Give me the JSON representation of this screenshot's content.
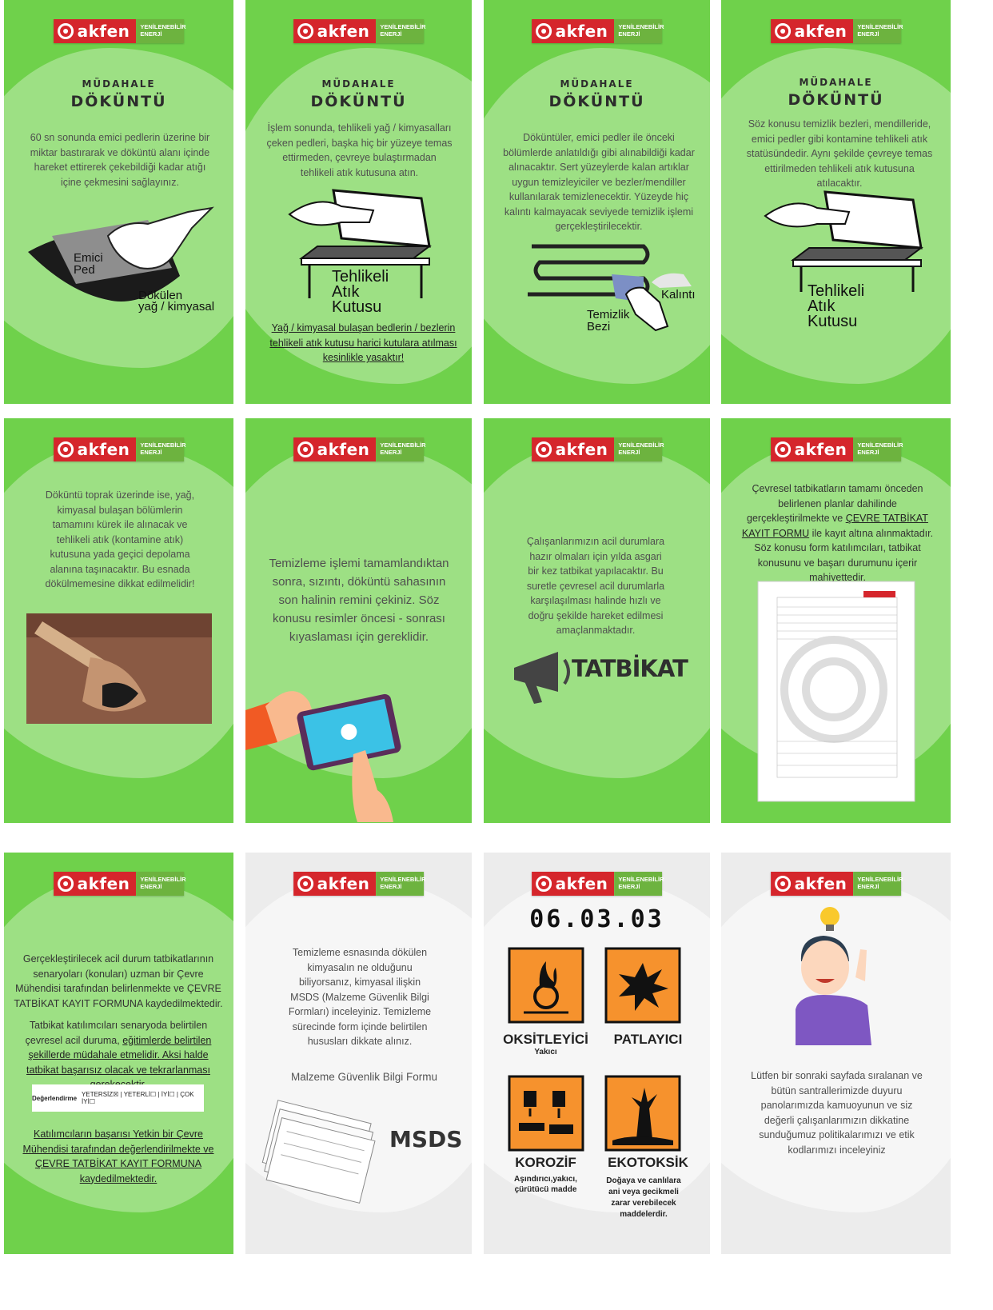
{
  "logo": {
    "brand": "akfen",
    "sub1": "YENİLENEBİLİR",
    "sub2": "ENERJİ"
  },
  "heading": {
    "top": "MÜDAHALE",
    "main": "DÖKÜNTÜ"
  },
  "c1": {
    "text": "60 sn sonunda emici pedlerin üzerine bir miktar bastırarak ve döküntü alanı içinde hareket ettirerek çekebildiği kadar atığı içine çekmesini sağlayınız.",
    "label1a": "Emici",
    "label1b": "Ped",
    "label2a": "Dökülen",
    "label2b": "yağ / kimyasal"
  },
  "c2": {
    "text": "İşlem sonunda, tehlikeli yağ / kimyasalları çeken pedleri, başka hiç bir yüzeye temas ettirmeden, çevreye bulaştırmadan tehlikeli atık kutusuna atın.",
    "box1": "Tehlikeli",
    "box2": "Atık",
    "box3": "Kutusu",
    "warning": "Yağ / kimyasal bulaşan bedlerin / bezlerin tehlikeli atık kutusu harici kutulara atılması kesinlikle yasaktır!"
  },
  "c3": {
    "text": "Döküntüler, emici pedler ile önceki bölümlerde anlatıldığı gibi alınabildiği kadar alınacaktır. Sert yüzeylerde kalan artıklar uygun temizleyiciler ve bezler/mendiller kullanılarak temizlenecektir. Yüzeyde hiç kalıntı kalmayacak seviyede temizlik işlemi gerçekleştirilecektir.",
    "residue": "Kalıntı",
    "cloth1": "Temizlik",
    "cloth2": "Bezi"
  },
  "c4": {
    "text": "Söz konusu temizlik bezleri, mendilleride, emici pedler gibi kontamine tehlikeli atık statüsündedir. Aynı şekilde çevreye temas ettirilmeden tehlikeli atık kutusuna atılacaktır.",
    "box1": "Tehlikeli",
    "box2": "Atık",
    "box3": "Kutusu"
  },
  "c5": {
    "text": "Döküntü toprak üzerinde ise, yağ, kimyasal bulaşan bölümlerin tamamını kürek ile alınacak ve tehlikeli atık (kontamine atık) kutusuna yada geçici depolama alanına taşınacaktır. Bu esnada dökülmemesine dikkat edilmelidir!"
  },
  "c6": {
    "text": "Temizleme işlemi tamamlandıktan sonra, sızıntı, döküntü sahasının son halinin remini çekiniz. Söz konusu resimler öncesi - sonrası kıyaslaması için gereklidir."
  },
  "c7": {
    "text": "Çalışanlarımızın acil durumlara hazır olmaları için yılda asgari bir kez tatbikat yapılacaktır. Bu suretle çevresel acil durumlarla karşılaşılması halinde hızlı ve doğru şekilde hareket edilmesi amaçlanmaktadır.",
    "title": "TATBİKAT"
  },
  "c8": {
    "text_a": "Çevresel tatbikatların tamamı önceden belirlenen planlar dahilinde gerçekleştirilmekte ve ",
    "link": "ÇEVRE TATBİKAT KAYIT FORMU",
    "text_b": " ile kayıt altına alınmaktadır. Söz konusu form katılımcıları, tatbikat konusunu ve başarı durumunu içerir mahiyettedir."
  },
  "c9": {
    "p1": "Gerçekleştirilecek acil durum tatbikatlarının senaryoları (konuları) uzman bir Çevre Mühendisi tarafından belirlenmekte ve ÇEVRE TATBİKAT KAYIT FORMUNA kaydedilmektedir.",
    "p2a": "Tatbikat katılımcıları senaryoda belirtilen çevresel acil duruma, ",
    "p2b": "eğitimlerde belirtilen şekillerde müdahale etmelidir. Aksi halde tatbikat başarısız olacak ve tekrarlanması gerekecektir.",
    "eval": "Değerlendirme",
    "opts": "YETERSİZ☒ | YETERLİ☐ | İYİ☐ | ÇOK İYİ☐",
    "p3": "Katılımcıların başarısı Yetkin bir Çevre Mühendisi tarafından değerlendirilmekte ve ÇEVRE TATBİKAT KAYIT FORMUNA kaydedilmektedir."
  },
  "c10": {
    "text": "Temizleme esnasında dökülen kimyasalın ne olduğunu biliyorsanız, kimyasal ilişkin MSDS (Malzeme Güvenlik Bilgi Formları) inceleyiniz. Temizleme sürecinde form içinde belirtilen hususları dikkate alınız.",
    "subtitle": "Malzeme Güvenlik Bilgi Formu",
    "msds": "MSDS"
  },
  "c11": {
    "code": "06.03.03",
    "h1": "OKSİTLEYİCİ",
    "h1s": "Yakıcı",
    "h2": "PATLAYICI",
    "h3": "KOROZİF",
    "h3s": "Aşındırıcı,yakıcı, çürütücü madde",
    "h4": "EKOTOKSİK",
    "h4s": "Doğaya ve canlılara ani veya gecikmeli zarar verebilecek maddelerdir."
  },
  "c12": {
    "text": "Lütfen bir sonraki sayfada sıralanan ve bütün santrallerimizde duyuru panolarımızda kamuoyunun ve siz değerli çalışanlarımızın dikkatine sunduğumuz politikalarımızı ve etik kodlarımızı inceleyiniz"
  },
  "colors": {
    "green": "#6fd14b",
    "red": "#d5262c",
    "orange": "#f6922d"
  }
}
